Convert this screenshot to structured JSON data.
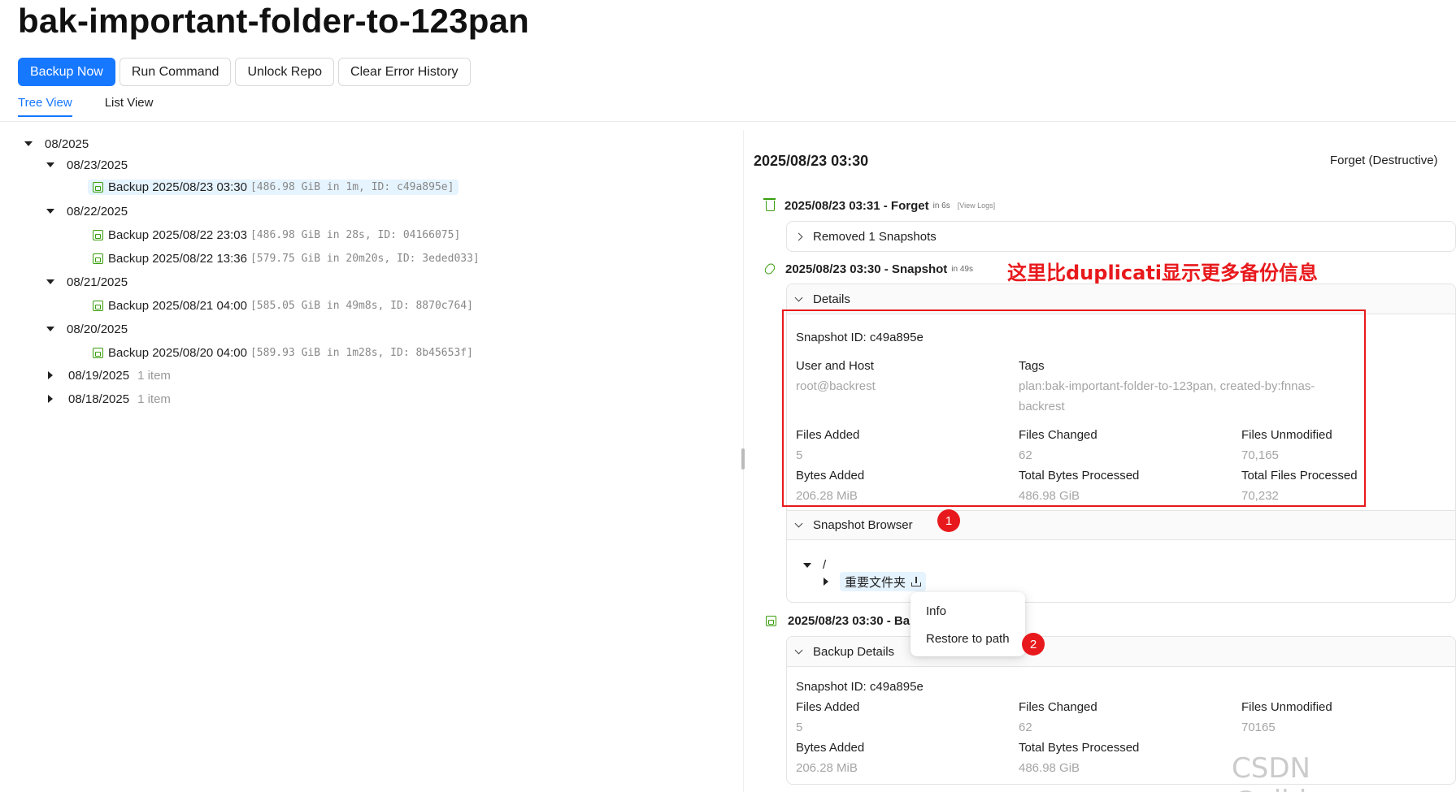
{
  "page": {
    "title": "bak-important-folder-to-123pan"
  },
  "toolbar": {
    "backup_now": "Backup Now",
    "run_command": "Run Command",
    "unlock_repo": "Unlock Repo",
    "clear_error_history": "Clear Error History"
  },
  "tabs": {
    "tree_view": "Tree View",
    "list_view": "List View"
  },
  "tree": {
    "month": "08/2025",
    "days": [
      {
        "date": "08/23/2025",
        "snapshots": [
          {
            "label": "Backup 2025/08/23 03:30",
            "meta": "[486.98 GiB in 1m, ID: c49a895e]"
          }
        ]
      },
      {
        "date": "08/22/2025",
        "snapshots": [
          {
            "label": "Backup 2025/08/22 23:03",
            "meta": "[486.98 GiB in 28s, ID: 04166075]"
          },
          {
            "label": "Backup 2025/08/22 13:36",
            "meta": "[579.75 GiB in 20m20s, ID: 3eded033]"
          }
        ]
      },
      {
        "date": "08/21/2025",
        "snapshots": [
          {
            "label": "Backup 2025/08/21 04:00",
            "meta": "[585.05 GiB in 49m8s, ID: 8870c764]"
          }
        ]
      },
      {
        "date": "08/20/2025",
        "snapshots": [
          {
            "label": "Backup 2025/08/20 04:00",
            "meta": "[589.93 GiB in 1m28s, ID: 8b45653f]"
          }
        ]
      },
      {
        "date": "08/19/2025",
        "count": "1 item"
      },
      {
        "date": "08/18/2025",
        "count": "1 item"
      }
    ]
  },
  "detail": {
    "title": "2025/08/23 03:30",
    "forget_link": "Forget (Destructive)",
    "forget_op": {
      "title": "2025/08/23 03:31 - Forget",
      "duration": "in 6s",
      "view_logs": "[View Logs]",
      "removed": "Removed 1 Snapshots"
    },
    "snapshot_op": {
      "title": "2025/08/23 03:30 - Snapshot",
      "duration": "in 49s"
    },
    "annotation": "这里比duplicati显示更多备份信息",
    "details": {
      "header": "Details",
      "snapshot_id": "Snapshot ID: c49a895e",
      "user_host_label": "User and Host",
      "user_host_value": "root@backrest",
      "tags_label": "Tags",
      "tags_line1": "plan:bak-important-folder-to-123pan, created-by:fnnas-",
      "tags_line2": "backrest",
      "files_added_label": "Files Added",
      "files_added": "5",
      "files_changed_label": "Files Changed",
      "files_changed": "62",
      "files_unmodified_label": "Files Unmodified",
      "files_unmodified": "70,165",
      "bytes_added_label": "Bytes Added",
      "bytes_added": "206.28 MiB",
      "total_bytes_label": "Total Bytes Processed",
      "total_bytes": "486.98 GiB",
      "total_files_label": "Total Files Processed",
      "total_files": "70,232"
    },
    "browser": {
      "header": "Snapshot Browser",
      "root": "/",
      "folder": "重要文件夹"
    },
    "context_menu": {
      "info": "Info",
      "restore": "Restore to path"
    },
    "backup_op": {
      "title": "2025/08/23 03:30 - Ba"
    },
    "backup_details": {
      "header": "Backup Details",
      "snapshot_id": "Snapshot ID: c49a895e",
      "files_added_label": "Files Added",
      "files_added": "5",
      "files_changed_label": "Files Changed",
      "files_changed": "62",
      "files_unmodified_label": "Files Unmodified",
      "files_unmodified": "70165",
      "bytes_added_label": "Bytes Added",
      "bytes_added": "206.28 MiB",
      "total_bytes_label": "Total Bytes Processed",
      "total_bytes": "486.98 GiB"
    },
    "badges": [
      "1",
      "2"
    ]
  },
  "watermark": "CSDN @zibingogo",
  "colors": {
    "primary": "#1677ff",
    "success": "#389e0d",
    "annotation": "#e8191c"
  }
}
